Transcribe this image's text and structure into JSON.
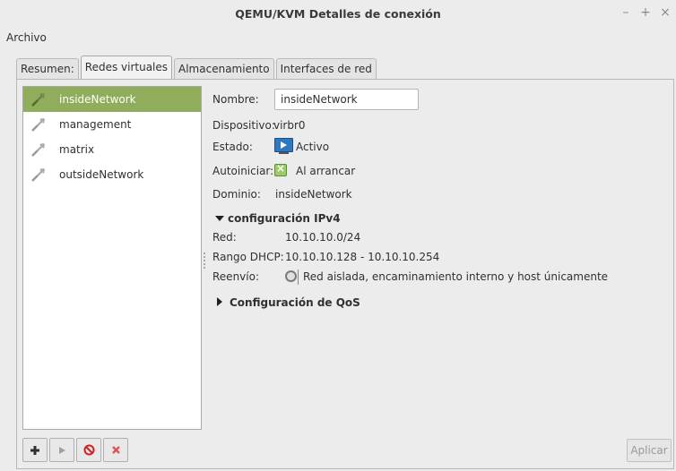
{
  "window": {
    "title": "QEMU/KVM Detalles de conexión",
    "controls": {
      "minimize": "–",
      "maximize": "+",
      "close": "×"
    }
  },
  "menu": {
    "archivo": "Archivo"
  },
  "tabs": [
    {
      "label": "Resumen:",
      "active": false
    },
    {
      "label": "Redes virtuales",
      "active": true
    },
    {
      "label": "Almacenamiento",
      "active": false
    },
    {
      "label": "Interfaces de red",
      "active": false
    }
  ],
  "networks": [
    {
      "label": "insideNetwork",
      "selected": true
    },
    {
      "label": "management",
      "selected": false
    },
    {
      "label": "matrix",
      "selected": false
    },
    {
      "label": "outsideNetwork",
      "selected": false
    }
  ],
  "details": {
    "nombre_label": "Nombre:",
    "nombre_value": "insideNetwork",
    "dispositivo_label": "Dispositivo:",
    "dispositivo_value": "virbr0",
    "estado_label": "Estado:",
    "estado_value": "Activo",
    "autoiniciar_label": "Autoiniciar:",
    "autoiniciar_value": "Al arrancar",
    "dominio_label": "Dominio:",
    "dominio_value": "insideNetwork",
    "ipv4_header": "configuración IPv4",
    "red_label": "Red:",
    "red_value": "10.10.10.0/24",
    "dhcp_label": "Rango DHCP:",
    "dhcp_value": "10.10.10.128 - 10.10.10.254",
    "reenvio_label": "Reenvío:",
    "reenvio_value": "Red aislada, encaminamiento interno y host únicamente",
    "qos_header": "Configuración de QoS"
  },
  "toolbar": {
    "add_icon": "plus-icon",
    "start_icon": "play-icon",
    "stop_icon": "stop-icon",
    "delete_icon": "delete-icon"
  },
  "apply_label": "Aplicar",
  "colors": {
    "selection": "#8fad5a",
    "stop_red": "#d02020"
  }
}
